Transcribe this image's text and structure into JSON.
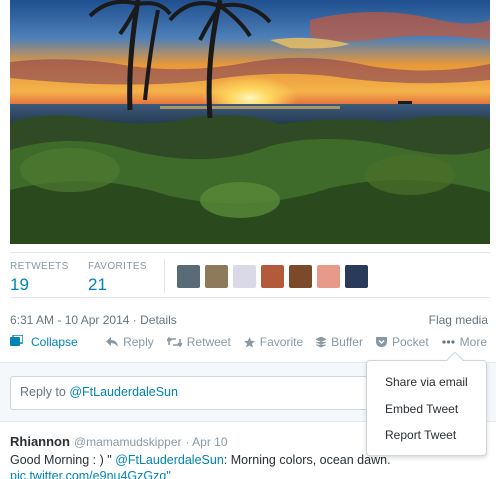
{
  "stats": {
    "retweets_label": "RETWEETS",
    "retweets_count": "19",
    "favorites_label": "FAVORITES",
    "favorites_count": "21",
    "avatar_colors": [
      "#5a6b78",
      "#8c7a5a",
      "#d9d9e8",
      "#b35a3a",
      "#7a4a2a",
      "#e89a8a",
      "#2a3a5a"
    ]
  },
  "meta": {
    "timestamp": "6:31 AM - 10 Apr 2014",
    "separator": "·",
    "details": "Details",
    "flag_media": "Flag media"
  },
  "actions": {
    "collapse": "Collapse",
    "reply": "Reply",
    "retweet": "Retweet",
    "favorite": "Favorite",
    "buffer": "Buffer",
    "pocket": "Pocket",
    "more": "More"
  },
  "reply_box": {
    "prefix": "Reply to ",
    "mention": "@FtLauderdaleSun"
  },
  "more_menu": {
    "items": [
      "Share via email",
      "Embed Tweet",
      "Report Tweet"
    ]
  },
  "reply_tweet": {
    "name": "Rhiannon",
    "handle": "@mamamudskipper",
    "date": "· Apr 10",
    "text_start": "Good Morning : ) \" ",
    "mention": "@FtLauderdaleSun",
    "text_end": ": Morning colors, ocean dawn.",
    "link": "pic.twitter.com/e9nu4GzGzq\""
  },
  "colors": {
    "link_blue": "#0084b4",
    "muted_gray": "#8899a6"
  }
}
